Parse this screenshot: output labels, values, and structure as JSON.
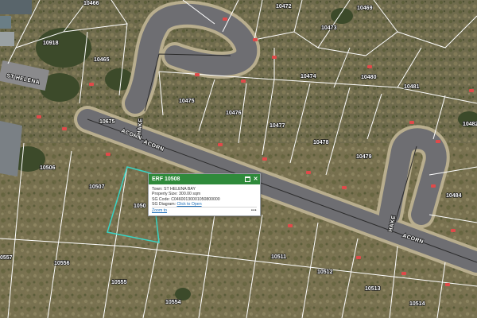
{
  "map": {
    "parcels": [
      {
        "id": "10466",
        "label": "10466"
      },
      {
        "id": "10918",
        "label": "10918"
      },
      {
        "id": "10465",
        "label": "10465"
      },
      {
        "id": "10472",
        "label": "10472"
      },
      {
        "id": "10469",
        "label": "10469"
      },
      {
        "id": "10473",
        "label": "10473"
      },
      {
        "id": "10474",
        "label": "10474"
      },
      {
        "id": "10480",
        "label": "10480"
      },
      {
        "id": "10481",
        "label": "10481"
      },
      {
        "id": "10475",
        "label": "10475"
      },
      {
        "id": "10476",
        "label": "10476"
      },
      {
        "id": "10477",
        "label": "10477"
      },
      {
        "id": "10478",
        "label": "10478"
      },
      {
        "id": "10479",
        "label": "10479"
      },
      {
        "id": "10482",
        "label": "10482"
      },
      {
        "id": "10675",
        "label": "10675"
      },
      {
        "id": "10506",
        "label": "10506"
      },
      {
        "id": "10507",
        "label": "10507"
      },
      {
        "id": "10508",
        "label": "1050"
      },
      {
        "id": "10484",
        "label": "10484"
      },
      {
        "id": "10557",
        "label": "0557"
      },
      {
        "id": "10556",
        "label": "10556"
      },
      {
        "id": "10555",
        "label": "10555"
      },
      {
        "id": "10511",
        "label": "10511"
      },
      {
        "id": "10512",
        "label": "10512"
      },
      {
        "id": "10513",
        "label": "10513"
      },
      {
        "id": "10514",
        "label": "10514"
      },
      {
        "id": "10554",
        "label": "10554"
      }
    ],
    "streets": [
      {
        "id": "st-helena",
        "label": "ST HELENA"
      },
      {
        "id": "acorn-1",
        "label": "ACORN"
      },
      {
        "id": "acorn-2",
        "label": "ACORN"
      },
      {
        "id": "hake-1",
        "label": "HAKE"
      },
      {
        "id": "hake-2",
        "label": "HAKE"
      },
      {
        "id": "acorn-3",
        "label": "ACORN"
      }
    ],
    "colors": {
      "road": "#6b6b6e",
      "road_edge": "#b5aa8c",
      "parcel_line": "#ffffff",
      "selected_parcel": "#39d3c4",
      "dim_badge": "#e04a4a",
      "vegetation": "#6e6a4c"
    }
  },
  "popup": {
    "title": "ERF 10508",
    "town_label": "Town:",
    "town_value": "ST HELENA BAY",
    "size_label": "Property Size:",
    "size_value": "300.00 sqm",
    "sg_code_label": "SG Code:",
    "sg_code_value": "C04600130001050800000",
    "sg_diagram_label": "SG Diagram:",
    "sg_diagram_link": "Click to Open",
    "zoom_link": "Zoom to",
    "more": "•••",
    "maximize_icon": "maximize-icon",
    "close_icon": "close-icon",
    "close_glyph": "✕"
  }
}
